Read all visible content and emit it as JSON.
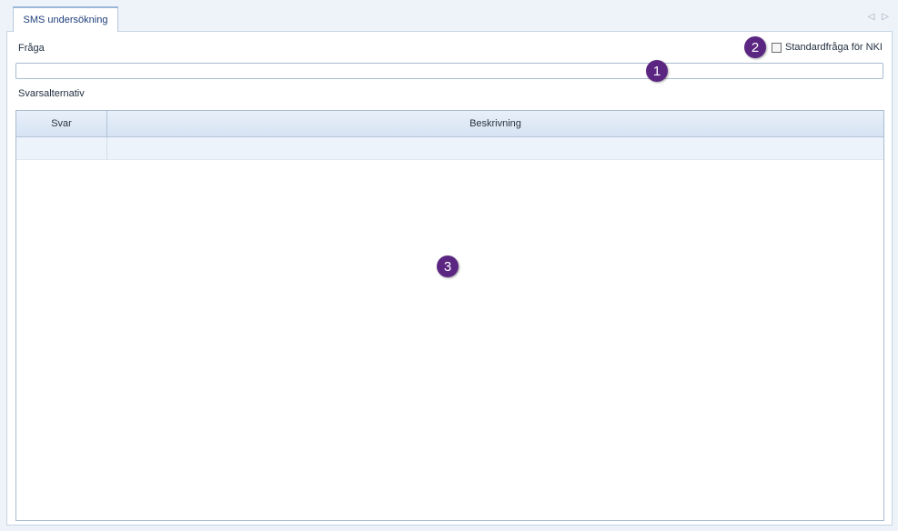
{
  "tab": {
    "label": "SMS undersökning"
  },
  "nav": {
    "prev_glyph": "◁",
    "next_glyph": "▷"
  },
  "form": {
    "question_label": "Fråga",
    "question_value": "",
    "nki_checkbox_label": "Standardfråga för NKI",
    "nki_checked": false,
    "answers_label": "Svarsalternativ"
  },
  "grid": {
    "columns": [
      "Svar",
      "Beskrivning"
    ],
    "rows": [
      {
        "svar": "",
        "beskrivning": ""
      }
    ]
  },
  "badges": [
    "1",
    "2",
    "3"
  ],
  "colors": {
    "badge": "#5b2682",
    "tab_text": "#1f3f7a",
    "border": "#a9bbd0"
  }
}
